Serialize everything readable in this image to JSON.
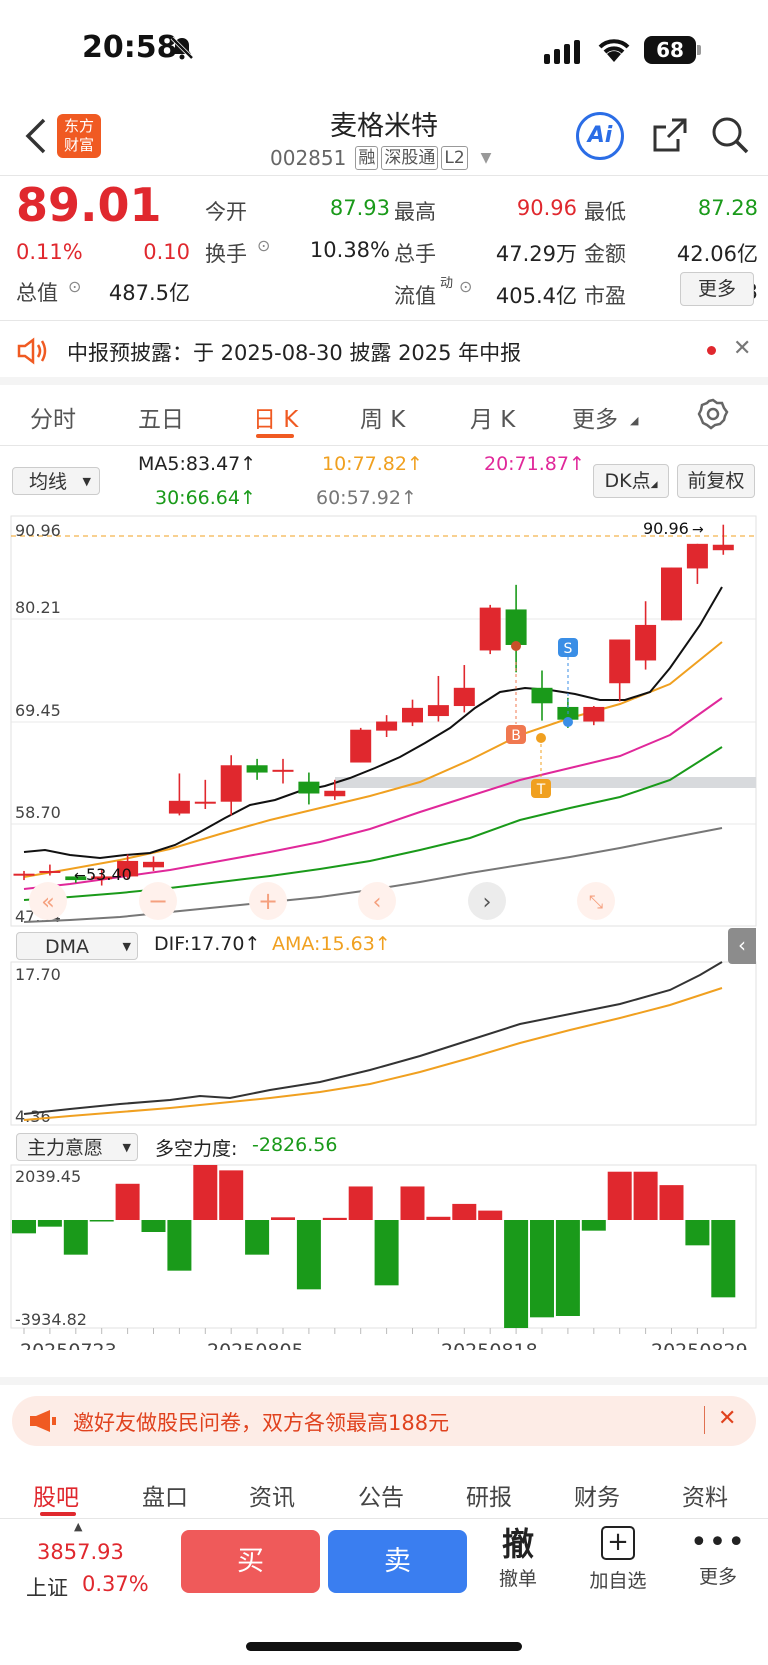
{
  "status_bar": {
    "time": "20:58",
    "battery": "68"
  },
  "header": {
    "title": "麦格米特",
    "code": "002851",
    "tags": [
      "融",
      "深股通",
      "L2"
    ],
    "logo_text": "东方财富",
    "ai_label": "Ai"
  },
  "quote": {
    "price": "89.01",
    "change_pct": "0.11%",
    "change": "0.10",
    "stats": [
      {
        "label": "今开",
        "value": "87.93",
        "color": "#1a9a1a"
      },
      {
        "label": "最高",
        "value": "90.96",
        "color": "#e0282e"
      },
      {
        "label": "最低",
        "value": "87.28",
        "color": "#1a9a1a"
      },
      {
        "label": "换手",
        "value": "10.38%",
        "color": "#222222"
      },
      {
        "label": "总手",
        "value": "47.29万",
        "color": "#222222"
      },
      {
        "label": "金额",
        "value": "42.06亿",
        "color": "#222222"
      },
      {
        "label": "总值",
        "value": "487.5亿",
        "color": "#222222"
      },
      {
        "label": "流值",
        "value": "405.4亿",
        "color": "#222222"
      },
      {
        "label": "市盈",
        "value": "113.63",
        "color": "#222222"
      }
    ],
    "more_label": "更多",
    "pe_sup": "动"
  },
  "notice": {
    "text": "中报预披露：于 2025-08-30 披露 2025 年中报"
  },
  "tabs": [
    "分时",
    "五日",
    "日 K",
    "周 K",
    "月 K",
    "更多"
  ],
  "active_tab": 2,
  "ma": {
    "selector": "均线",
    "items": [
      {
        "label": "MA5:83.47↑",
        "color": "#111111"
      },
      {
        "label": "10:77.82↑",
        "color": "#f0a020"
      },
      {
        "label": "20:71.87↑",
        "color": "#e0289a"
      },
      {
        "label": "30:66.64↑",
        "color": "#1a9a1a"
      },
      {
        "label": "60:57.92↑",
        "color": "#777777"
      }
    ],
    "dk_label": "DK点",
    "fq_label": "前复权"
  },
  "chart_data": [
    {
      "type": "candlestick",
      "y_ticks": [
        "90.96",
        "80.21",
        "69.45",
        "58.70",
        "47.94"
      ],
      "ylim": [
        47.94,
        90.96
      ],
      "high_label": "90.96",
      "low_label": "53.40",
      "markers": [
        "B",
        "S",
        "T"
      ],
      "candles": [
        [
          53.9,
          53.9,
          53.2,
          54.2
        ],
        [
          54.0,
          54.2,
          53.7,
          54.9
        ],
        [
          53.6,
          53.2,
          52.9,
          53.8
        ],
        [
          53.3,
          53.6,
          52.6,
          54.3
        ],
        [
          53.6,
          55.3,
          53.3,
          56.0
        ],
        [
          54.6,
          55.2,
          54.2,
          55.8
        ],
        [
          60.5,
          61.9,
          60.3,
          64.9
        ],
        [
          61.8,
          61.8,
          61.0,
          64.2
        ],
        [
          61.8,
          65.8,
          60.3,
          66.9
        ],
        [
          65.8,
          65.0,
          64.2,
          66.5
        ],
        [
          65.3,
          65.3,
          63.8,
          66.5
        ],
        [
          64.0,
          62.7,
          61.5,
          65.0
        ],
        [
          62.4,
          63.0,
          62.0,
          64.2
        ],
        [
          66.1,
          69.7,
          66.1,
          69.9
        ],
        [
          69.6,
          70.6,
          68.9,
          71.3
        ],
        [
          70.5,
          72.1,
          70.1,
          73.0
        ],
        [
          71.2,
          72.4,
          70.6,
          75.6
        ],
        [
          72.3,
          74.3,
          71.6,
          76.8
        ],
        [
          78.4,
          83.1,
          78.0,
          83.4
        ],
        [
          82.9,
          79.0,
          76.0,
          85.6
        ],
        [
          74.3,
          72.6,
          70.7,
          76.2
        ],
        [
          72.2,
          70.8,
          69.9,
          73.2
        ],
        [
          70.6,
          72.2,
          70.2,
          72.3
        ],
        [
          74.8,
          79.6,
          72.8,
          79.6
        ],
        [
          77.3,
          81.2,
          76.3,
          83.8
        ],
        [
          81.7,
          87.5,
          81.7,
          87.5
        ],
        [
          87.4,
          90.1,
          85.7,
          90.1
        ],
        [
          89.4,
          90.0,
          88.9,
          92.2
        ]
      ]
    },
    {
      "type": "line",
      "title": "DMA",
      "series": [
        {
          "name": "DIF",
          "label": "DIF:17.70↑"
        },
        {
          "name": "AMA",
          "label": "AMA:15.63↑"
        }
      ],
      "y_ticks": [
        "17.70",
        "4.36"
      ]
    },
    {
      "type": "bar",
      "title": "主力意愿",
      "label": "多空力度:",
      "value": "-2826.56",
      "y_ticks": [
        "2039.45",
        "-3934.82"
      ],
      "values": [
        -500,
        -250,
        -1300,
        -30,
        1350,
        -450,
        -1900,
        2050,
        1850,
        -1300,
        100,
        -2600,
        80,
        1250,
        -2450,
        1250,
        120,
        600,
        350,
        -4050,
        -3650,
        -3600,
        -400,
        1800,
        1800,
        1300,
        -950,
        -2900
      ],
      "x_ticks": [
        "20250723",
        "20250805",
        "20250818",
        "20250829"
      ]
    }
  ],
  "promo": {
    "text": "邀好友做股民问卷，双方各领最高188元"
  },
  "bottom_tabs": [
    "股吧",
    "盘口",
    "资讯",
    "公告",
    "研报",
    "财务",
    "资料"
  ],
  "toolbar": {
    "index_value": "3857.93",
    "index_name": "上证",
    "index_change": "0.37%",
    "buy": "买",
    "sell": "卖",
    "cancel_glyph": "撤",
    "cancel_label": "撤单",
    "add_label": "加自选",
    "more_label": "更多"
  }
}
